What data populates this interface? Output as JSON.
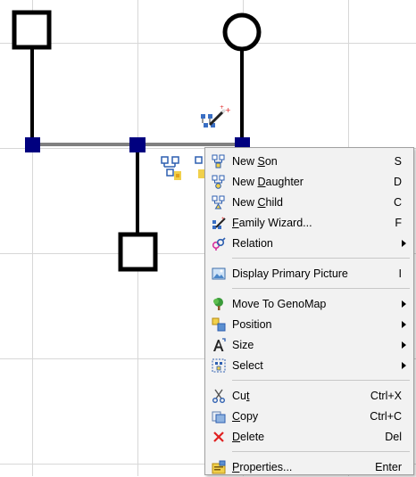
{
  "menu": {
    "items": [
      {
        "pre": "New ",
        "u": "S",
        "post": "on",
        "shortcut": "S",
        "icon": "new-son-icon"
      },
      {
        "pre": "New ",
        "u": "D",
        "post": "aughter",
        "shortcut": "D",
        "icon": "new-daughter-icon"
      },
      {
        "pre": "New ",
        "u": "C",
        "post": "hild",
        "shortcut": "C",
        "icon": "new-child-icon"
      },
      {
        "pre": "",
        "u": "F",
        "post": "amily Wizard...",
        "shortcut": "F",
        "icon": "family-wizard-icon"
      },
      {
        "pre": "Relation",
        "u": "",
        "post": "",
        "shortcut": "",
        "icon": "relation-icon",
        "submenu": true
      },
      {
        "pre": "Display Primary Picture",
        "u": "",
        "post": "",
        "shortcut": "I",
        "icon": "display-picture-icon"
      },
      {
        "pre": "Move To GenoMap",
        "u": "",
        "post": "",
        "shortcut": "",
        "icon": "genomap-tree-icon",
        "submenu": true
      },
      {
        "pre": "Position",
        "u": "",
        "post": "",
        "shortcut": "",
        "icon": "position-icon",
        "submenu": true
      },
      {
        "pre": "Size",
        "u": "",
        "post": "",
        "shortcut": "",
        "icon": "size-icon",
        "submenu": true
      },
      {
        "pre": "Select",
        "u": "",
        "post": "",
        "shortcut": "",
        "icon": "select-icon",
        "submenu": true
      },
      {
        "pre": "Cu",
        "u": "t",
        "post": "",
        "shortcut": "Ctrl+X",
        "icon": "scissors-icon"
      },
      {
        "pre": "",
        "u": "C",
        "post": "opy",
        "shortcut": "Ctrl+C",
        "icon": "copy-icon"
      },
      {
        "pre": "",
        "u": "D",
        "post": "elete",
        "shortcut": "Del",
        "icon": "delete-x-icon"
      },
      {
        "pre": "",
        "u": "P",
        "post": "roperties...",
        "shortcut": "Enter",
        "icon": "properties-icon"
      }
    ]
  },
  "colors": {
    "line": "#000000",
    "marriage": "#808080",
    "handle": "#00007f",
    "menu_bg": "#f2f2f2"
  }
}
